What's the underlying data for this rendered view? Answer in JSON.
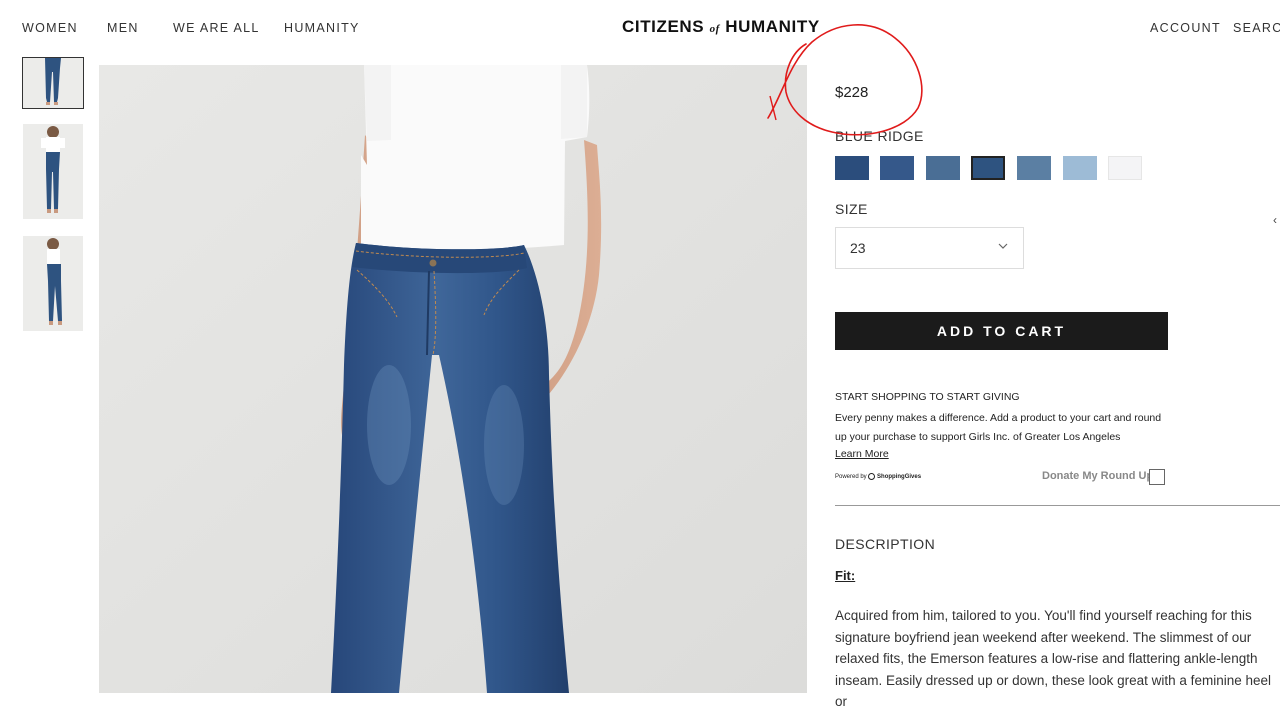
{
  "header": {
    "nav_left": [
      "WOMEN",
      "MEN",
      "WE ARE ALL",
      "HUMANITY"
    ],
    "logo": {
      "part1": "CITIZENS",
      "part2": "of",
      "part3": "HUMANITY"
    },
    "nav_right": [
      "ACCOUNT",
      "SEARCH"
    ]
  },
  "product": {
    "price": "$228",
    "color_name": "BLUE RIDGE",
    "swatches": [
      {
        "color": "#2b4d7c"
      },
      {
        "color": "#35588a"
      },
      {
        "color": "#4a6e95"
      },
      {
        "color": "#2e5380",
        "selected": true
      },
      {
        "color": "#5b7fa3"
      },
      {
        "color": "#9dbbd6"
      },
      {
        "color": "#f4f4f6"
      }
    ],
    "size_label": "SIZE",
    "size_value": "23",
    "add_to_cart": "ADD TO CART"
  },
  "giving": {
    "title": "START SHOPPING TO START GIVING",
    "text": "Every penny makes a difference. Add a product to your cart and round up your purchase to support Girls Inc. of Greater Los Angeles",
    "learn_more": "Learn More",
    "powered_by": "Powered by",
    "powered_brand": "ShoppingGives",
    "donate_label": "Donate My Round Up"
  },
  "description": {
    "heading": "DESCRIPTION",
    "fit_label": "Fit:",
    "text": "Acquired from him, tailored to you. You'll find yourself reaching for this signature boyfriend jean weekend after weekend. The slimmest of our relaxed fits, the Emerson features a low-rise and flattering ankle-length inseam. Easily dressed up or down, these look great with a feminine heel or"
  },
  "colors": {
    "accent": "#1b1b1b",
    "annotation": "#e01b1b",
    "denim": "#2e5380"
  }
}
